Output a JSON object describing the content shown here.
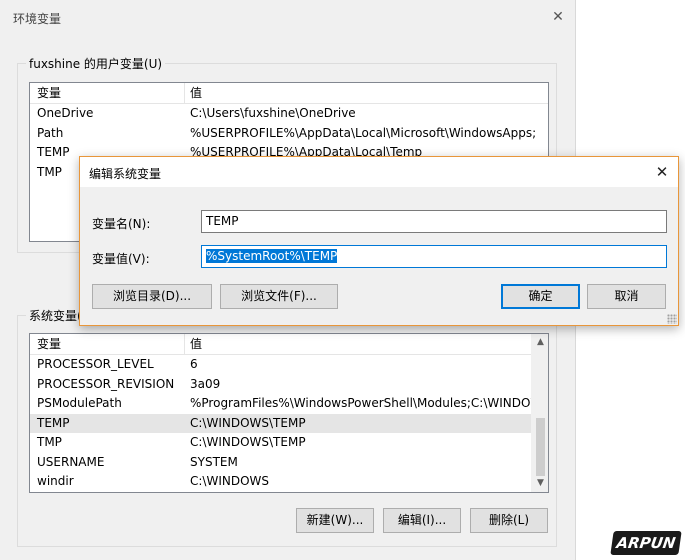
{
  "window": {
    "title": "环境变量",
    "close_icon": "close-icon"
  },
  "user_vars": {
    "legend": "fuxshine 的用户变量(U)",
    "columns": [
      "变量",
      "值"
    ],
    "rows": [
      {
        "name": "OneDrive",
        "value": "C:\\Users\\fuxshine\\OneDrive"
      },
      {
        "name": "Path",
        "value": "%USERPROFILE%\\AppData\\Local\\Microsoft\\WindowsApps;"
      },
      {
        "name": "TEMP",
        "value": "%USERPROFILE%\\AppData\\Local\\Temp"
      },
      {
        "name": "TMP",
        "value": ""
      }
    ]
  },
  "system_vars": {
    "legend": "系统变量(S",
    "columns": [
      "变量",
      "值"
    ],
    "rows": [
      {
        "name": "PROCESSOR_LEVEL",
        "value": "6"
      },
      {
        "name": "PROCESSOR_REVISION",
        "value": "3a09"
      },
      {
        "name": "PSModulePath",
        "value": "%ProgramFiles%\\WindowsPowerShell\\Modules;C:\\WINDOW..."
      },
      {
        "name": "TEMP",
        "value": "C:\\WINDOWS\\TEMP"
      },
      {
        "name": "TMP",
        "value": "C:\\WINDOWS\\TEMP"
      },
      {
        "name": "USERNAME",
        "value": "SYSTEM"
      },
      {
        "name": "windir",
        "value": "C:\\WINDOWS"
      }
    ],
    "selected_row": "TEMP",
    "buttons": {
      "new": "新建(W)...",
      "edit": "编辑(I)...",
      "delete": "删除(L)"
    }
  },
  "edit_dialog": {
    "title": "编辑系统变量",
    "name_label": "变量名(N):",
    "name_value": "TEMP",
    "value_label": "变量值(V):",
    "value_value": "%SystemRoot%\\TEMP",
    "buttons": {
      "browse_dir": "浏览目录(D)...",
      "browse_file": "浏览文件(F)...",
      "ok": "确定",
      "cancel": "取消"
    }
  },
  "watermark": "ARPUN",
  "colors": {
    "accent": "#0078d7",
    "dialog_border": "#e8963a",
    "selection": "#e5e5e5"
  }
}
